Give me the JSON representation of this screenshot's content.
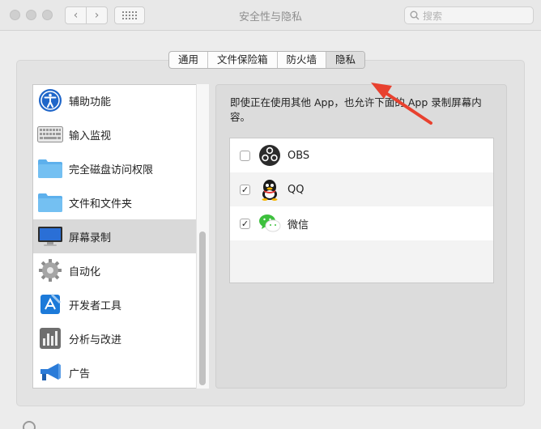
{
  "window": {
    "title": "安全性与隐私",
    "search_placeholder": "搜索"
  },
  "tabs": [
    {
      "label": "通用"
    },
    {
      "label": "文件保险箱"
    },
    {
      "label": "防火墙"
    },
    {
      "label": "隐私",
      "active": true
    }
  ],
  "sidebar": {
    "items": [
      {
        "label": "辅助功能",
        "icon": "accessibility-icon"
      },
      {
        "label": "输入监视",
        "icon": "keyboard-icon"
      },
      {
        "label": "完全磁盘访问权限",
        "icon": "folder-icon"
      },
      {
        "label": "文件和文件夹",
        "icon": "folder-icon"
      },
      {
        "label": "屏幕录制",
        "icon": "monitor-icon",
        "selected": true
      },
      {
        "label": "自动化",
        "icon": "gear-icon"
      },
      {
        "label": "开发者工具",
        "icon": "developer-tools-icon"
      },
      {
        "label": "分析与改进",
        "icon": "analytics-icon"
      },
      {
        "label": "广告",
        "icon": "megaphone-icon"
      }
    ]
  },
  "main": {
    "description": "即使正在使用其他 App，也允许下面的 App 录制屏幕内容。",
    "apps": [
      {
        "name": "OBS",
        "checked": false,
        "icon": "obs-icon"
      },
      {
        "name": "QQ",
        "checked": true,
        "icon": "qq-icon"
      },
      {
        "name": "微信",
        "checked": true,
        "icon": "wechat-icon"
      }
    ]
  },
  "colors": {
    "arrow": "#e8412f",
    "selected_row": "#d9d9d9",
    "wechat_green": "#3dc03d"
  }
}
